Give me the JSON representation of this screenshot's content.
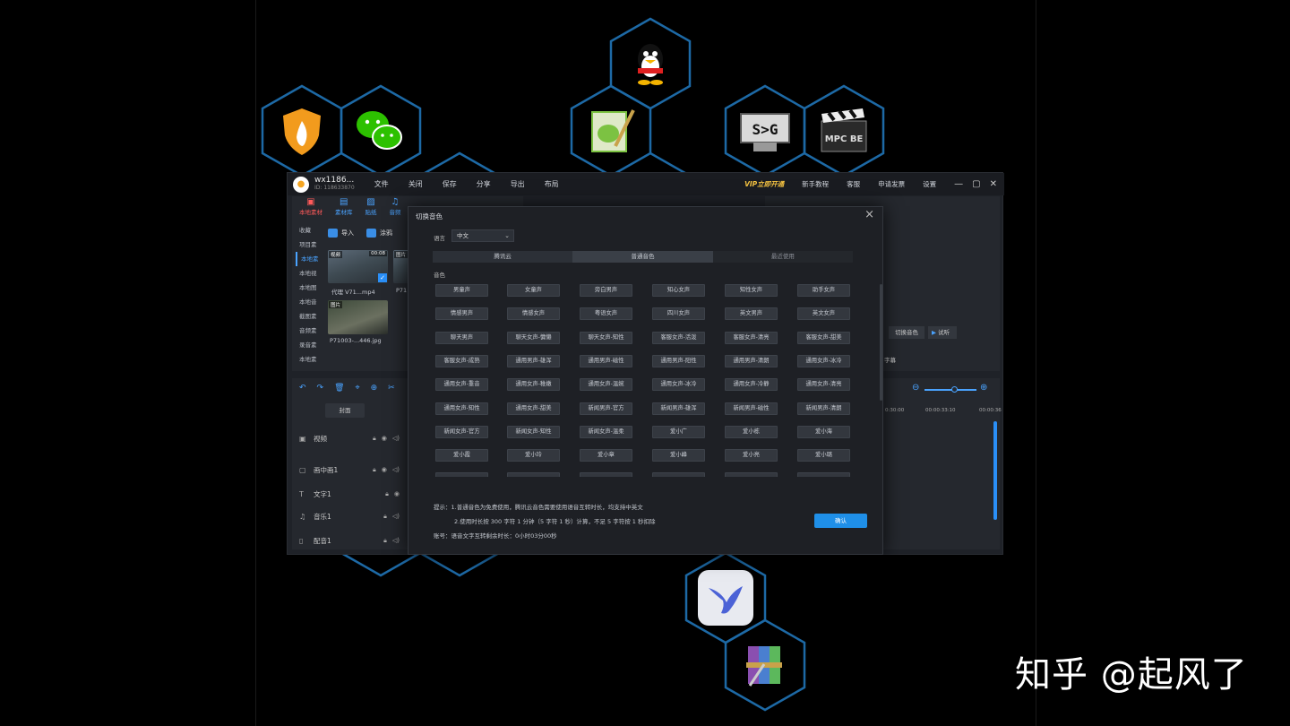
{
  "app": {
    "user_name": "wx1186...",
    "user_id": "ID: 118633870",
    "menu": [
      "文件",
      "关闭",
      "保存",
      "分享",
      "导出",
      "布局"
    ],
    "vip": "VIP立即开通",
    "right_links": [
      "新手教程",
      "客服",
      "申请发票",
      "设置"
    ]
  },
  "left_panel": {
    "tools": [
      {
        "label": "本地素材"
      },
      {
        "label": "素材库"
      },
      {
        "label": "贴纸"
      },
      {
        "label": "音频"
      }
    ],
    "side_items": [
      "收藏",
      "项目素",
      "本地素",
      "本地视",
      "本地图",
      "本地音",
      "截图素",
      "音频素",
      "录音素",
      "本地素"
    ],
    "import_label": "导入",
    "paint_label": "涂鸦",
    "thumbs": [
      {
        "tag": "视频",
        "duration": "00:08",
        "caption": "代理  V71...mp4"
      },
      {
        "tag": "图片",
        "caption": "P71"
      },
      {
        "tag": "图片",
        "caption": "P71003-...446.jpg"
      }
    ]
  },
  "timeline": {
    "cover_label": "封面",
    "tracks": [
      {
        "label": "视频",
        "icon": "film-icon"
      },
      {
        "label": "画中画1",
        "icon": "pip-icon"
      },
      {
        "label": "文字1",
        "icon": "text-icon"
      },
      {
        "label": "音乐1",
        "icon": "music-icon"
      },
      {
        "label": "配音1",
        "icon": "mic-icon"
      }
    ],
    "time_labels": [
      "0:30:00",
      "00:00:33:10",
      "00:00:36"
    ]
  },
  "right_panel": {
    "switch_voice": "切换音色",
    "preview": "试听",
    "subtitle_fragment": "字幕"
  },
  "dialog": {
    "title": "切换音色",
    "language_label": "语言",
    "language_value": "中文",
    "tabs": [
      "腾讯云",
      "普通音色",
      "最近使用"
    ],
    "section_label": "音色",
    "voices": [
      "男童声",
      "女童声",
      "旁白男声",
      "知心女声",
      "知性女声",
      "助手女声",
      "情感男声",
      "情感女声",
      "粤语女声",
      "四川女声",
      "英文男声",
      "英文女声",
      "聊天男声",
      "聊天女声-慵懒",
      "聊天女声-知性",
      "客服女声-活泼",
      "客服女声-清亮",
      "客服女声-甜美",
      "客服女声-成熟",
      "通用男声-雄浑",
      "通用男声-磁性",
      "通用男声-阳性",
      "通用男声-清朗",
      "通用女声-冰冷",
      "通用女声-重音",
      "通用女声-稚嫩",
      "通用女声-温婉",
      "通用女声-冰冷",
      "通用女声-冷静",
      "通用女声-清亮",
      "通用女声-知性",
      "通用女声-甜美",
      "新闻男声-官方",
      "新闻男声-雄浑",
      "新闻男声-磁性",
      "新闻男声-清朗",
      "新闻女声-官方",
      "新闻女声-知性",
      "新闻女声-温柔",
      "爱小广",
      "爱小栋",
      "爱小海",
      "爱小霞",
      "爱小玲",
      "爱小章",
      "爱小峰",
      "爱小亮",
      "爱小璐"
    ],
    "hint1": "提示：1.普通音色为免费使用，腾讯云音色需要使用语音互转时长，均支持中英文",
    "hint2": "2.使用时长按 300 字符 1 分钟（5 字符 1 秒）计算，不足 5 字符按 1 秒扣除",
    "hint3": "账号：语音文字互转剩余时长：0小时03分00秒",
    "confirm_label": "确认"
  },
  "hex_icons": [
    {
      "name": "shield-fire-icon",
      "color": "#f29b1d"
    },
    {
      "name": "wechat-icon",
      "color": "#2dc100"
    },
    {
      "name": "qq-penguin-icon",
      "color": "#1f1f1f"
    },
    {
      "name": "notepad-icon",
      "color": "#7cc242"
    },
    {
      "name": "sed-icon",
      "color": "#d9d9d9",
      "text": "S>G"
    },
    {
      "name": "mpc-be-icon",
      "color": "#2a2a2a",
      "text": "MPC BE"
    },
    {
      "name": "feige-bird-icon",
      "color": "#6a7fd8"
    },
    {
      "name": "winrar-icon",
      "color": "#8a4fb0"
    }
  ],
  "watermark": "知乎 @起风了"
}
